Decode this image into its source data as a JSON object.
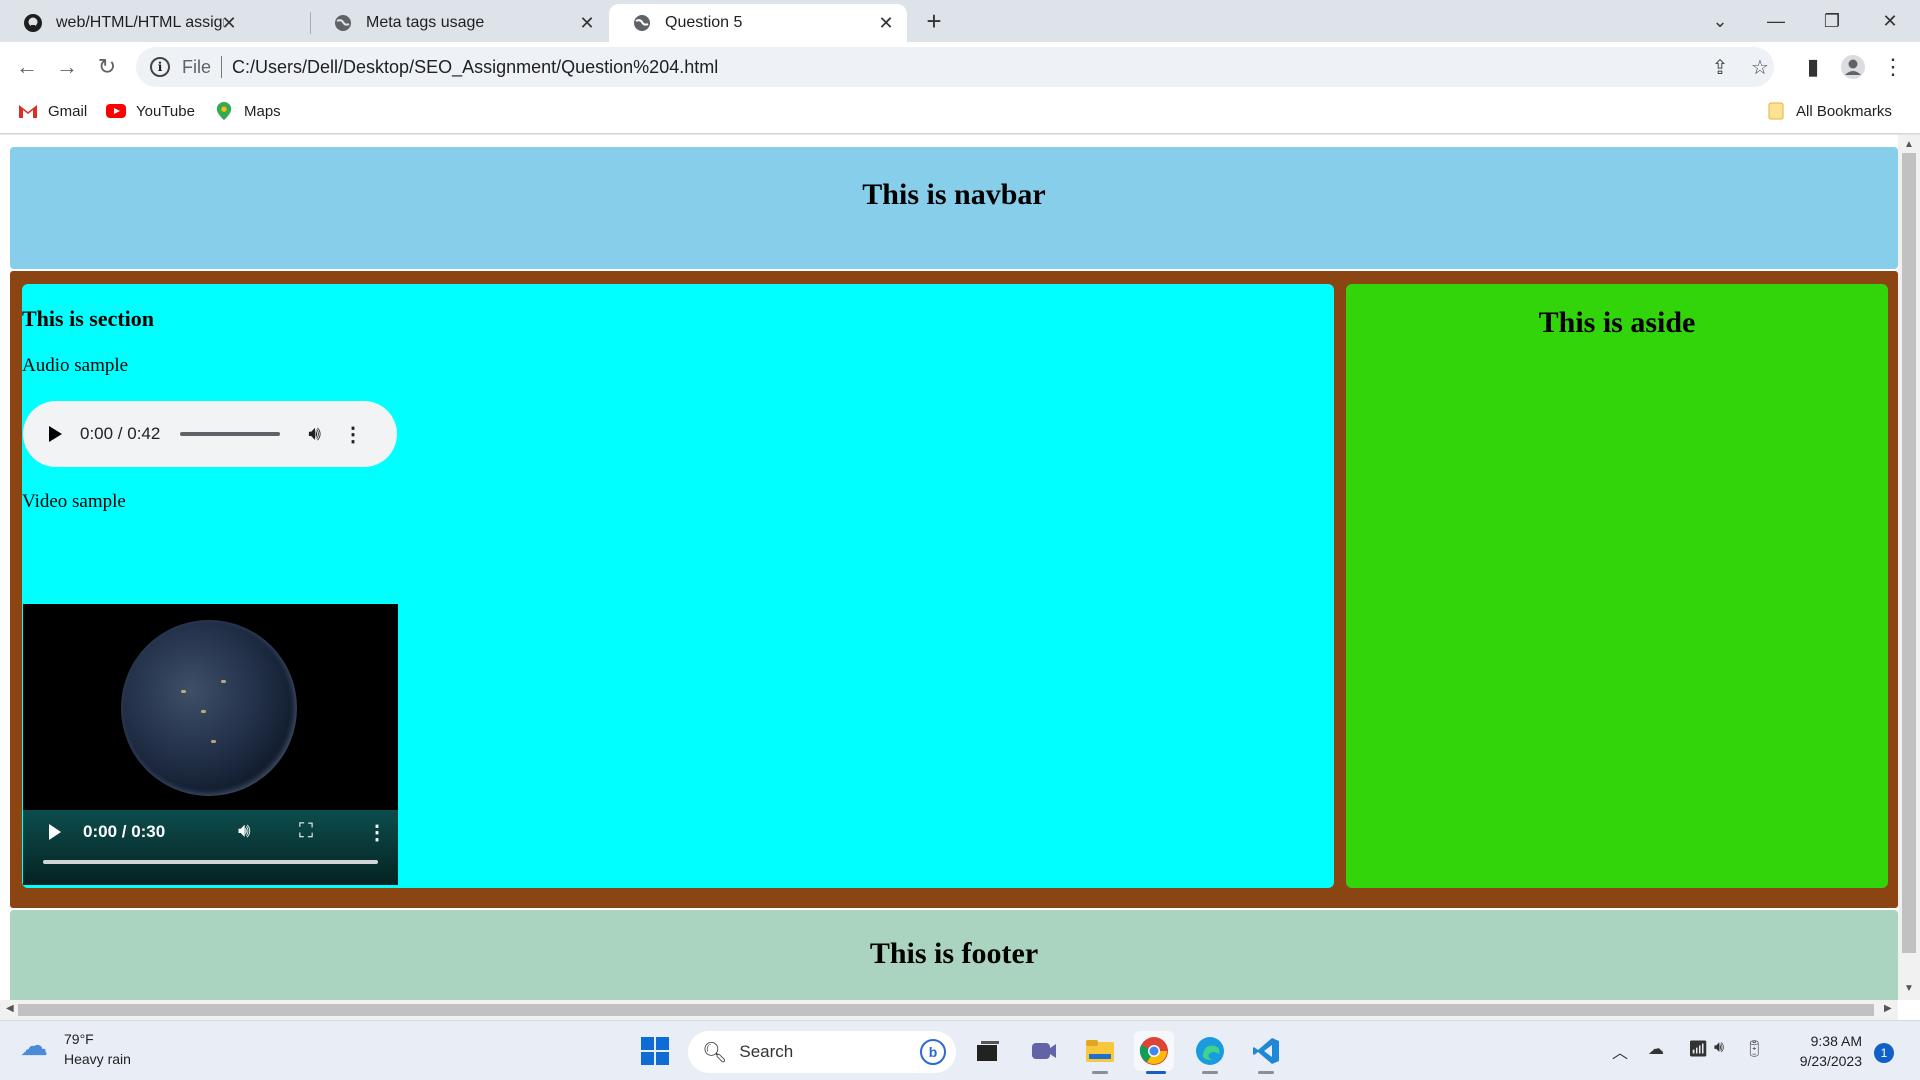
{
  "browser": {
    "tabs": [
      {
        "title": "web/HTML/HTML assignments/M",
        "favicon": "github-icon",
        "active": false
      },
      {
        "title": "Meta tags usage",
        "favicon": "globe-icon",
        "active": false
      },
      {
        "title": "Question 5",
        "favicon": "globe-icon",
        "active": true
      }
    ],
    "address": {
      "scheme": "File",
      "url": "C:/Users/Dell/Desktop/SEO_Assignment/Question%204.html"
    },
    "bookmarks": [
      {
        "label": "Gmail",
        "icon": "gmail-icon"
      },
      {
        "label": "YouTube",
        "icon": "youtube-icon"
      },
      {
        "label": "Maps",
        "icon": "maps-icon"
      }
    ],
    "all_bookmarks": "All Bookmarks"
  },
  "page": {
    "navbar": "This is navbar",
    "section": {
      "heading": "This is section",
      "audio_label": "Audio sample",
      "audio_time": "0:00 / 0:42",
      "video_label": "Video sample",
      "video_time": "0:00 / 0:30"
    },
    "aside": "This is aside",
    "footer": "This is footer",
    "colors": {
      "navbar": "#87ceeb",
      "main": "#8b4513",
      "section": "#00ffff",
      "aside": "#32d40a",
      "footer": "#aad4bf"
    }
  },
  "taskbar": {
    "weather": {
      "temp": "79°F",
      "condition": "Heavy rain"
    },
    "search_placeholder": "Search",
    "time": "9:38 AM",
    "date": "9/23/2023",
    "notifications": "1"
  }
}
